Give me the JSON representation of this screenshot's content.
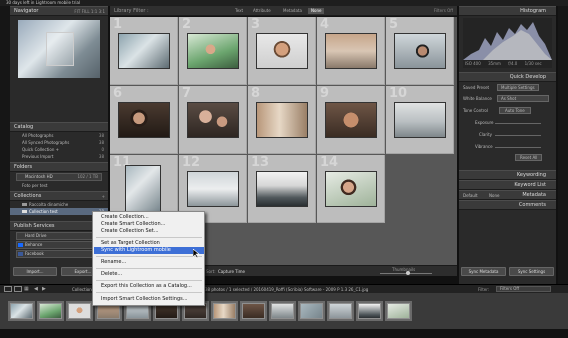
{
  "window": {
    "title": "30 days left in Lightroom mobile trial"
  },
  "left_panel": {
    "navigator": {
      "title": "Navigator",
      "zoom_options": [
        "FIT",
        "FILL",
        "1:1",
        "3:1"
      ]
    },
    "catalog": {
      "title": "Catalog",
      "items": [
        {
          "label": "All Photographs",
          "count": "38"
        },
        {
          "label": "All Synced Photographs",
          "count": "38"
        },
        {
          "label": "Quick Collection +",
          "count": "0"
        },
        {
          "label": "Previous Import",
          "count": "38"
        }
      ]
    },
    "folders": {
      "title": "Folders",
      "volume": "Macintosh HD",
      "volume_info": "102 / 1 TB",
      "folder": "Foto per test"
    },
    "collections": {
      "title": "Collections",
      "items": [
        {
          "label": "Raccolta dinamiche"
        },
        {
          "label": "Collection test",
          "count": "38"
        }
      ]
    },
    "publish": {
      "title": "Publish Services",
      "services": [
        "Hard Drive",
        "Behance",
        "Facebook"
      ]
    },
    "import_label": "Import...",
    "export_label": "Export..."
  },
  "toolbar": {
    "title": "Library Filter :",
    "filters": [
      "Text",
      "Attribute",
      "Metadata",
      "None"
    ],
    "filters_off": "Filters Off"
  },
  "grid": {
    "cells": [
      {
        "num": "1"
      },
      {
        "num": "2"
      },
      {
        "num": "3"
      },
      {
        "num": "4"
      },
      {
        "num": "5"
      },
      {
        "num": "6"
      },
      {
        "num": "7"
      },
      {
        "num": "8"
      },
      {
        "num": "9"
      },
      {
        "num": "10"
      },
      {
        "num": "11"
      },
      {
        "num": "12"
      },
      {
        "num": "13"
      },
      {
        "num": "14"
      }
    ]
  },
  "statusbar": {
    "sort_label": "Sort:",
    "sort_value": "Capture Time",
    "thumbnails_label": "Thumbnails"
  },
  "right_panel": {
    "histogram": {
      "title": "Histogram",
      "readouts": [
        "ISO 400",
        "35mm",
        "f/4.0",
        "1/30 sec"
      ]
    },
    "quick_develop": {
      "title": "Quick Develop",
      "saved_preset_label": "Saved Preset",
      "saved_preset_value": "Multiple Settings",
      "white_balance_label": "White Balance",
      "white_balance_value": "As Shot",
      "tone_control_label": "Tone Control",
      "auto_tone": "Auto Tone",
      "rows": [
        "Exposure",
        "Clarity",
        "Vibrance"
      ],
      "reset_all": "Reset All"
    },
    "keywording": {
      "title": "Keywording"
    },
    "keyword_list": {
      "title": "Keyword List"
    },
    "metadata": {
      "title": "Metadata",
      "preset": "Default",
      "sub": "None"
    },
    "comments": {
      "title": "Comments"
    },
    "sync_metadata": "Sync Metadata",
    "sync_settings": "Sync Settings"
  },
  "filmbar": {
    "source_label": "Collection : Collection test",
    "info": "38 photos / 1 selected / 20160419_Roffi (Scribia) Software - 2009 P 1.3 26_C1.jpg ",
    "filter_label": "Filter:",
    "filter_value": "Filters Off"
  },
  "context_menu": {
    "items": [
      "Create Collection...",
      "Create Smart Collection...",
      "Create Collection Set...",
      "Set as Target Collection",
      "Sync with Lightroom mobile",
      "Rename...",
      "Delete...",
      "Export this Collection as a Catalog...",
      "Import Smart Collection Settings..."
    ],
    "highlighted_index": 4
  }
}
